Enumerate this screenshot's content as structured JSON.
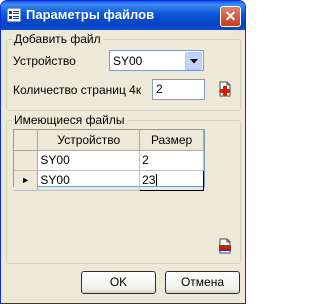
{
  "window": {
    "title": "Параметры файлов",
    "close_glyph": "✕"
  },
  "add_group": {
    "title": "Добавить файл",
    "device_label": "Устройство",
    "device_value": "SY00",
    "pages_label": "Количество страниц 4к",
    "pages_value": "2"
  },
  "files_group": {
    "title": "Имеющиеся файлы",
    "columns": [
      "Устройство",
      "Размер"
    ],
    "rows": [
      {
        "device": "SY00",
        "size": "2"
      },
      {
        "device": "SY00",
        "size": "23"
      }
    ],
    "current_row_glyph": "►"
  },
  "buttons": {
    "ok": "OK",
    "cancel": "Отмена"
  },
  "colors": {
    "titlebar": "#0a55d8",
    "dialog_bg": "#ece9d8",
    "accent_red": "#cc2200"
  }
}
